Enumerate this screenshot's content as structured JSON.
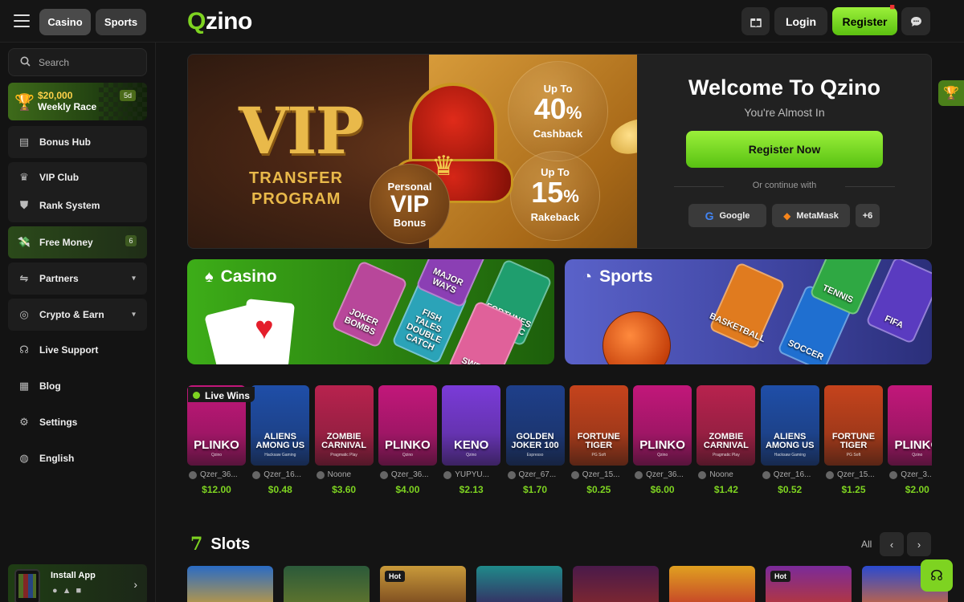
{
  "header": {
    "tabs": [
      "Casino",
      "Sports"
    ],
    "logo_q": "Q",
    "logo_rest": "zino",
    "login": "Login",
    "register": "Register"
  },
  "sidebar": {
    "search_placeholder": "Search",
    "race": {
      "amount": "$20,000",
      "label": "Weekly Race",
      "days": "5d"
    },
    "bonus_hub": "Bonus Hub",
    "vip_club": "VIP Club",
    "rank_system": "Rank System",
    "free_money": "Free Money",
    "free_money_count": "6",
    "partners": "Partners",
    "crypto_earn": "Crypto & Earn",
    "live_support": "Live Support",
    "blog": "Blog",
    "settings": "Settings",
    "language": "English",
    "install_app": "Install App"
  },
  "hero": {
    "vip": "VIP",
    "transfer": "TRANSFER",
    "program": "PROGRAM",
    "cashback_up_to": "Up To",
    "cashback_pct": "40",
    "cashback_label": "Cashback",
    "rakeback_up_to": "Up To",
    "rakeback_pct": "15",
    "rakeback_label": "Rakeback",
    "personal": "Personal",
    "personal_vip": "VIP",
    "personal_bonus": "Bonus",
    "welcome": "Welcome To Qzino",
    "almost": "You're Almost In",
    "register_now": "Register Now",
    "continue_with": "Or continue with",
    "google": "Google",
    "metamask": "MetaMask",
    "more": "+6"
  },
  "tiles": {
    "casino": "Casino",
    "sports": "Sports",
    "casino_cards": [
      "JOKER BOMBS",
      "FISH TALES DOUBLE CATCH",
      "FORTUNES OF AZTEC",
      "SWEET",
      "MAJOR WAYS"
    ],
    "sports_cards": [
      "BASKETBALL",
      "SOCCER",
      "TENNIS",
      "FIFA"
    ]
  },
  "live_wins": {
    "label": "Live Wins",
    "items": [
      {
        "game": "PLINKO",
        "provider": "Qzino",
        "user": "Qzer_36...",
        "amount": "$12.00",
        "color": "#c2177a"
      },
      {
        "game": "ALIENS AMONG US",
        "provider": "Hacksaw Gaming",
        "user": "Qzer_16...",
        "amount": "$0.48",
        "color": "#1f4ea8"
      },
      {
        "game": "ZOMBIE CARNIVAL",
        "provider": "Pragmatic Play",
        "user": "Noone",
        "amount": "$3.60",
        "color": "#b8224e"
      },
      {
        "game": "PLINKO",
        "provider": "Qzino",
        "user": "Qzer_36...",
        "amount": "$4.00",
        "color": "#c2177a"
      },
      {
        "game": "KENO",
        "provider": "Qzino",
        "user": "YUPYU...",
        "amount": "$2.13",
        "color": "#7a3bd8"
      },
      {
        "game": "GOLDEN JOKER 100",
        "provider": "Espresso",
        "user": "Qzer_67...",
        "amount": "$1.70",
        "color": "#1e3f8a"
      },
      {
        "game": "FORTUNE TIGER",
        "provider": "PG Soft",
        "user": "Qzer_15...",
        "amount": "$0.25",
        "color": "#c5431c"
      },
      {
        "game": "PLINKO",
        "provider": "Qzino",
        "user": "Qzer_36...",
        "amount": "$6.00",
        "color": "#c2177a"
      },
      {
        "game": "ZOMBIE CARNIVAL",
        "provider": "Pragmatic Play",
        "user": "Noone",
        "amount": "$1.42",
        "color": "#b8224e"
      },
      {
        "game": "ALIENS AMONG US",
        "provider": "Hacksaw Gaming",
        "user": "Qzer_16...",
        "amount": "$0.52",
        "color": "#1f4ea8"
      },
      {
        "game": "FORTUNE TIGER",
        "provider": "PG Soft",
        "user": "Qzer_15...",
        "amount": "$1.25",
        "color": "#c5431c"
      },
      {
        "game": "PLINKO",
        "provider": "Qzino",
        "user": "Qzer_3...",
        "amount": "$2.00",
        "color": "#c2177a"
      }
    ]
  },
  "slots": {
    "title": "Slots",
    "all": "All",
    "hot": "Hot"
  }
}
